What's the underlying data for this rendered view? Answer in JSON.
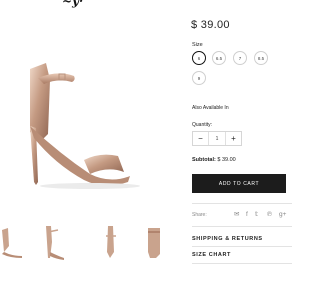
{
  "header": {
    "logo_text": "~ẙ·",
    "nav_fragments": [
      "·—·",
      "·—"
    ]
  },
  "product": {
    "price": "$ 39.00",
    "size_label": "Size",
    "sizes": [
      "6",
      "6.5",
      "7",
      "8.5",
      "9"
    ],
    "selected_size": "6",
    "availability": "Also Available In",
    "quantity_label": "Quantity:",
    "quantity_value": "1",
    "minus": "−",
    "plus": "+",
    "subtotal_label": "Subtotal:",
    "subtotal_value": "$ 39.00",
    "add_to_cart": "ADD TO CART"
  },
  "share": {
    "label": "Share:",
    "icons": [
      "mail-icon",
      "facebook-icon",
      "twitter-icon",
      "pinterest-icon",
      "google-plus-icon"
    ],
    "glyphs": [
      "✉",
      "f",
      "𝕥",
      "℗",
      "g+"
    ]
  },
  "accordion": {
    "shipping": "SHIPPING & RETURNS",
    "size_chart": "SIZE CHART"
  },
  "colors": {
    "accent_button": "#1c1c1c",
    "shoe_gold": "#c9a38d"
  }
}
